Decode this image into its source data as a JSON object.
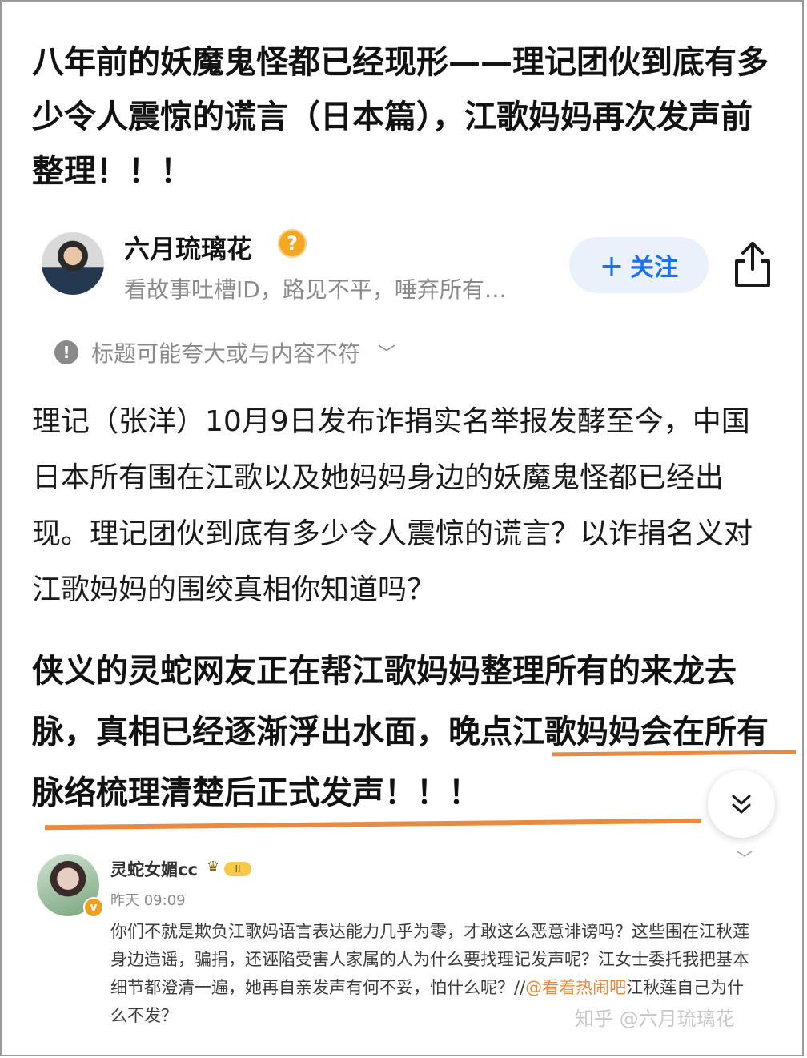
{
  "article": {
    "title": "八年前的妖魔鬼怪都已经现形——理记团伙到底有多少令人震惊的谎言（日本篇），江歌妈妈再次发声前整理！！！"
  },
  "author": {
    "name": "六月琉璃花",
    "badge_symbol": "?",
    "bio": "看故事吐槽ID，路见不平，唾弃所有…",
    "follow_label": "关注",
    "follow_icon": "plus-icon",
    "share_icon": "share-icon"
  },
  "notice": {
    "icon": "!",
    "text": "标题可能夸大或与内容不符"
  },
  "body": {
    "paragraph": "理记（张洋）10月9日发布诈捐实名举报发酵至今，中国日本所有围在江歌以及她妈妈身边的妖魔鬼怪都已经出现。理记团伙到底有多少令人震惊的谎言？以诈捐名义对江歌妈妈的围绞真相你知道吗？",
    "bold_paragraph": "侠义的灵蛇网友正在帮江歌妈妈整理所有的来龙去脉，真相已经逐渐浮出水面，晚点江歌妈妈会在所有脉络梳理清楚后正式发声！！！"
  },
  "comment": {
    "username": "灵蛇女媚cc",
    "level": "II",
    "verified_symbol": "v",
    "time": "昨天 09:09",
    "text": "你们不就是欺负江歌妈语言表达能力几乎为零，才敢这么恶意诽谤吗？这些围在江秋莲身边造谣，骗捐，还诬陷受害人家属的人为什么要找理记发声呢？江女士委托我把基本细节都澄清一遍，她再自亲发声有何不妥，怕什么呢？//",
    "mention": "@看着热闹吧",
    "text_end": "江秋莲自己为什么不发？"
  },
  "watermark": "知乎 @六月琉璃花",
  "colors": {
    "accent_blue": "#1772f6",
    "follow_bg": "#ebf1fb",
    "underline_orange": "#ea8a3f",
    "muted_gray": "#8a8a8a"
  }
}
